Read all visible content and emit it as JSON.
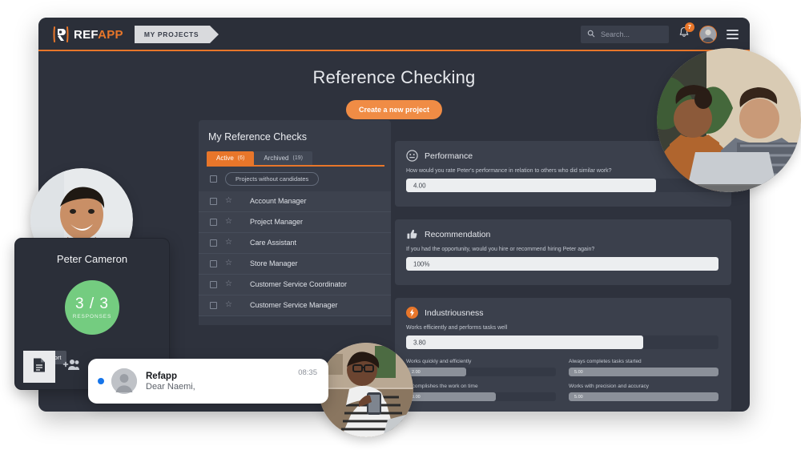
{
  "colors": {
    "accent": "#e8762a",
    "accent_light": "#f08c45",
    "window_bg": "#2e323d",
    "panel_bg": "#373c48",
    "card_bg": "#3b404c",
    "success_green": "#74cc80",
    "unread_blue": "#1675ea"
  },
  "topbar": {
    "logo_text_1": "REF",
    "logo_text_2": "APP",
    "logo_icon": "refapp-r-logo-icon",
    "projects_tab_label": "MY PROJECTS",
    "search_placeholder": "Search...",
    "search_value": "",
    "search_icon": "search-icon",
    "bell_icon": "bell-icon",
    "notification_count": "7",
    "avatar_icon": "user-avatar",
    "menu_icon": "hamburger-menu-icon"
  },
  "page": {
    "title": "Reference Checking",
    "create_button": "Create a new project"
  },
  "checks_panel": {
    "title": "My Reference Checks",
    "tabs": [
      {
        "label": "Active",
        "count": "(6)",
        "active": true
      },
      {
        "label": "Archived",
        "count": "(19)",
        "active": false
      }
    ],
    "filter_pill": "Projects without candidates",
    "rows": [
      {
        "label": "Account Manager"
      },
      {
        "label": "Project Manager"
      },
      {
        "label": "Care Assistant"
      },
      {
        "label": "Store Manager"
      },
      {
        "label": "Customer Service Coordinator"
      },
      {
        "label": "Customer Service Manager"
      }
    ]
  },
  "cards": {
    "performance": {
      "title": "Performance",
      "icon": "face-rating-icon",
      "question": "How would you rate Peter's performance in relation to others who did similar work?",
      "value": "4.00",
      "fill_percent": 80
    },
    "recommendation": {
      "title": "Recommendation",
      "icon": "thumbs-up-icon",
      "question": "If you had the opportunity, would you hire or recommend hiring Peter again?",
      "value": "100%",
      "fill_percent": 100
    },
    "industriousness": {
      "title": "Industriousness",
      "icon": "lightning-bolt-icon",
      "question": "Works efficiently and performs tasks well",
      "value": "3.80",
      "fill_percent": 76,
      "subitems": [
        {
          "label": "Works quickly and efficiently",
          "value": "2.00",
          "fill_percent": 40
        },
        {
          "label": "Always completes tasks started",
          "value": "5.00",
          "fill_percent": 100
        },
        {
          "label": "Accomplishes the work on time",
          "value": "3.00",
          "fill_percent": 60
        },
        {
          "label": "Works with precision and accuracy",
          "value": "5.00",
          "fill_percent": 100
        }
      ]
    }
  },
  "candidate_card": {
    "name": "Peter Cameron",
    "responses": "3 / 3",
    "responses_label": "RESPONSES",
    "tooltip": "Show report",
    "report_icon": "document-report-icon",
    "add_people_icon": "add-people-icon"
  },
  "toast": {
    "title": "Refapp",
    "body": "Dear Naemi,",
    "time": "08:35",
    "unread_dot": "unread-indicator",
    "avatar_icon": "user-avatar-placeholder"
  },
  "photos": {
    "candidate_portrait": "smiling-man-portrait-photo",
    "team_laptop": "two-colleagues-with-laptop-photo",
    "woman_phone": "woman-with-glasses-using-phone-photo"
  }
}
